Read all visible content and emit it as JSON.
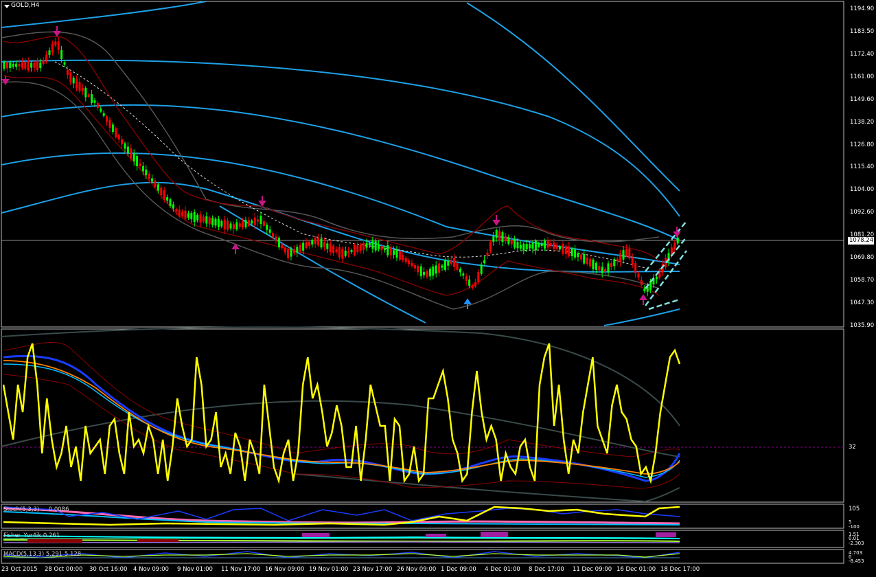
{
  "window": {
    "title": "GOLD,H4",
    "menu_icon": "triangle-down-icon"
  },
  "price_axis": {
    "labels": [
      "1194.90",
      "1183.50",
      "1172.40",
      "1161.00",
      "1149.60",
      "1138.20",
      "1126.80",
      "1115.40",
      "1104.00",
      "1092.60",
      "1081.20",
      "1069.80",
      "1058.70",
      "1047.30",
      "1035.90"
    ],
    "current_price": "1078.24"
  },
  "indicator_axis": {
    "level_label": "32",
    "stoch_labels": [
      "105",
      "5",
      "-100"
    ],
    "fisher_labels": [
      "1.51",
      "0.01",
      "-2.303"
    ],
    "macd_labels": [
      "4.703",
      "0",
      "-8.453"
    ]
  },
  "subwindows": {
    "stoch_label": "Stoch(5,3,3) ... 0.0086",
    "fisher_label": "Fisher_Yur4ik 0.261",
    "macd_label": "MACD(5,13,3) 5.291 5.128"
  },
  "time_axis": {
    "labels": [
      "23 Oct 2015",
      "28 Oct 00:00",
      "30 Oct 16:00",
      "4 Nov 09:00",
      "9 Nov 01:00",
      "11 Nov 17:00",
      "16 Nov 09:00",
      "19 Nov 01:00",
      "23 Nov 17:00",
      "26 Nov 09:00",
      "1 Dec 09:00",
      "4 Dec 01:00",
      "8 Dec 17:00",
      "11 Dec 09:00",
      "16 Dec 01:00",
      "18 Dec 17:00"
    ]
  },
  "colors": {
    "background": "#000000",
    "bull_candle": "#00ff00",
    "bear_candle": "#ff0000",
    "bands": "#1e90ff",
    "envelope": "#8b0000",
    "indicator_main": "#ffff00",
    "arrow_down": "#c71585",
    "arrow_up": "#1e90ff"
  }
}
